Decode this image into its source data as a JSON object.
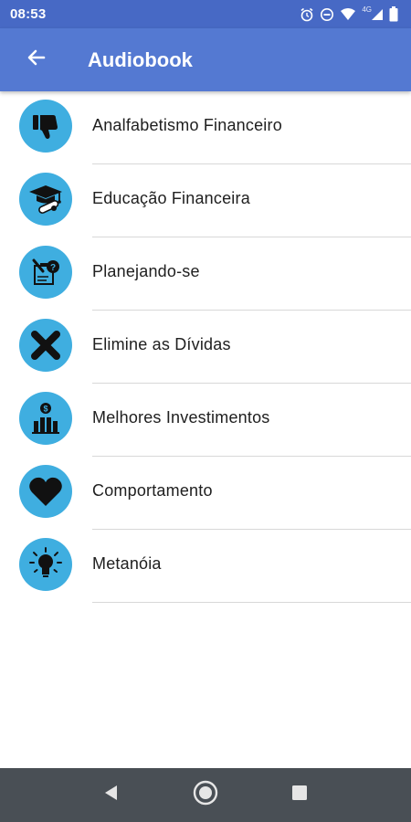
{
  "status_bar": {
    "time": "08:53",
    "network": "4G",
    "icons": [
      "alarm-icon",
      "do-not-disturb-icon",
      "wifi-icon",
      "cellular-signal-icon",
      "battery-icon"
    ]
  },
  "app_bar": {
    "title": "Audiobook",
    "back_icon": "arrow-back-icon",
    "color": "#5479d2"
  },
  "items": [
    {
      "label": "Analfabetismo Financeiro",
      "icon": "thumbs-down-icon"
    },
    {
      "label": "Educação Financeira",
      "icon": "graduation-cap-icon"
    },
    {
      "label": "Planejando-se",
      "icon": "planning-clipboard-icon"
    },
    {
      "label": "Elimine as Dívidas",
      "icon": "x-mark-icon"
    },
    {
      "label": "Melhores Investimentos",
      "icon": "investment-chart-icon"
    },
    {
      "label": "Comportamento",
      "icon": "heart-icon"
    },
    {
      "label": "Metanóia",
      "icon": "lightbulb-icon"
    }
  ],
  "nav_bar": {
    "buttons": [
      "back-triangle-icon",
      "home-circle-icon",
      "recents-square-icon"
    ]
  },
  "colors": {
    "status_bar": "#4769c5",
    "app_bar": "#5479d2",
    "icon_circle": "#3faee0",
    "nav_bar": "#494f55"
  }
}
